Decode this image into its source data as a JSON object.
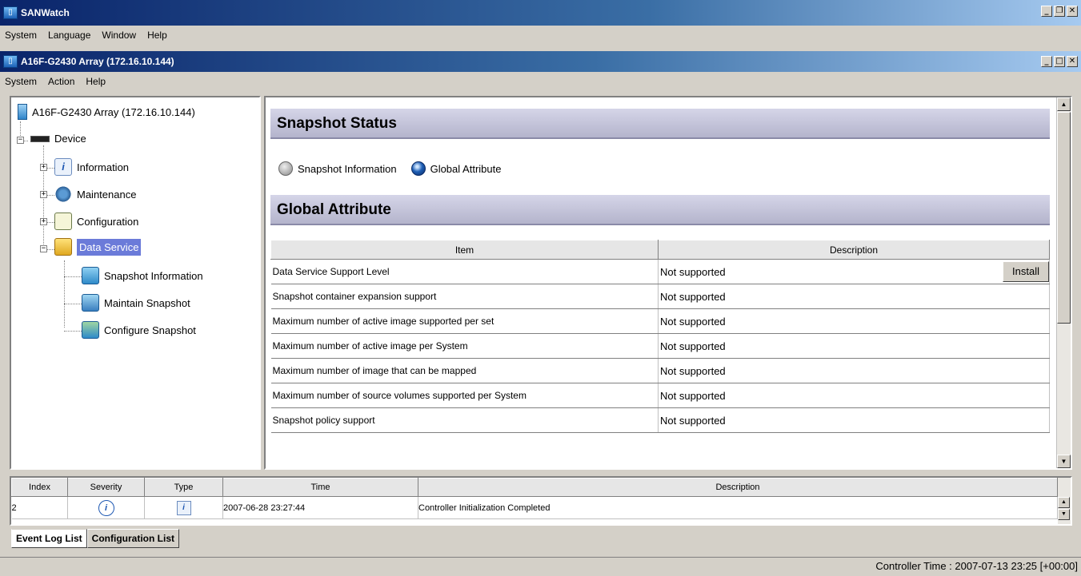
{
  "app": {
    "title": "SANWatch",
    "menu": [
      "System",
      "Language",
      "Window",
      "Help"
    ]
  },
  "window": {
    "title": "A16F-G2430 Array (172.16.10.144)",
    "menu": [
      "System",
      "Action",
      "Help"
    ]
  },
  "tree": {
    "root": "A16F-G2430 Array (172.16.10.144)",
    "device": "Device",
    "information": "Information",
    "maintenance": "Maintenance",
    "configuration": "Configuration",
    "data_service": "Data Service",
    "snapshot_information": "Snapshot Information",
    "maintain_snapshot": "Maintain Snapshot",
    "configure_snapshot": "Configure Snapshot"
  },
  "main": {
    "status_header": "Snapshot Status",
    "radio_snapshot": "Snapshot Information",
    "radio_global": "Global Attribute",
    "attr_header": "Global Attribute",
    "table": {
      "col_item": "Item",
      "col_description": "Description",
      "install_label": "Install",
      "rows": [
        {
          "item": "Data Service Support Level",
          "description": "Not supported"
        },
        {
          "item": "Snapshot container expansion support",
          "description": "Not supported"
        },
        {
          "item": "Maximum number of active image supported per set",
          "description": "Not supported"
        },
        {
          "item": "Maximum number of active image per System",
          "description": "Not supported"
        },
        {
          "item": "Maximum number of image that can be mapped",
          "description": "Not supported"
        },
        {
          "item": "Maximum number of source volumes supported per System",
          "description": "Not supported"
        },
        {
          "item": "Snapshot policy support",
          "description": "Not supported"
        }
      ]
    }
  },
  "eventlog": {
    "headers": [
      "Index",
      "Severity",
      "Type",
      "Time",
      "Description"
    ],
    "rows": [
      {
        "index": "2",
        "time": "2007-06-28 23:27:44",
        "description": "Controller Initialization Completed"
      }
    ]
  },
  "tabs": [
    "Event Log List",
    "Configuration List"
  ],
  "status": {
    "controller_time": "Controller Time : 2007-07-13 23:25 [+00:00]"
  },
  "colors": {
    "accent": "#0a246a",
    "selection": "#6b7bd9",
    "header_bg": "#c6c6dc"
  }
}
